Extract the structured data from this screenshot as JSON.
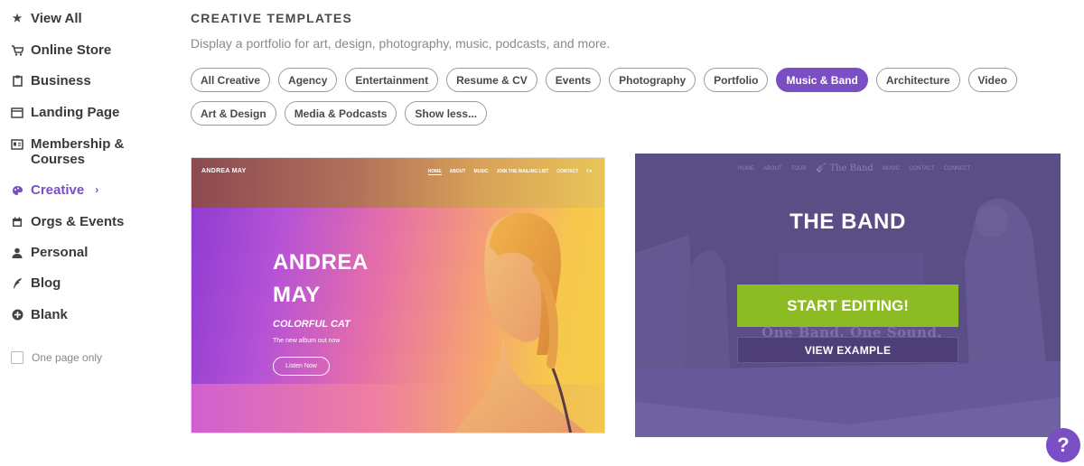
{
  "sidebar": {
    "items": [
      {
        "label": "View All",
        "icon": "star-icon"
      },
      {
        "label": "Online Store",
        "icon": "cart-icon"
      },
      {
        "label": "Business",
        "icon": "clipboard-icon"
      },
      {
        "label": "Landing Page",
        "icon": "browser-window-icon"
      },
      {
        "label": "Membership & Courses",
        "icon": "id-card-icon"
      },
      {
        "label": "Creative",
        "icon": "palette-icon",
        "active": true
      },
      {
        "label": "Orgs & Events",
        "icon": "calendar-icon"
      },
      {
        "label": "Personal",
        "icon": "person-icon"
      },
      {
        "label": "Blog",
        "icon": "quill-icon"
      },
      {
        "label": "Blank",
        "icon": "plus-circle-icon"
      }
    ],
    "one_page_only": "One page only"
  },
  "header": {
    "title": "CREATIVE TEMPLATES",
    "subtitle": "Display a portfolio for art, design, photography, music, podcasts, and more."
  },
  "filters": [
    {
      "label": "All Creative"
    },
    {
      "label": "Agency"
    },
    {
      "label": "Entertainment"
    },
    {
      "label": "Resume & CV"
    },
    {
      "label": "Events"
    },
    {
      "label": "Photography"
    },
    {
      "label": "Portfolio"
    },
    {
      "label": "Music & Band",
      "selected": true
    },
    {
      "label": "Architecture"
    },
    {
      "label": "Video"
    },
    {
      "label": "Art & Design"
    },
    {
      "label": "Media & Podcasts"
    },
    {
      "label": "Show less..."
    }
  ],
  "templates": {
    "andrea": {
      "logo": "ANDREA MAY",
      "menu": [
        "HOME",
        "ABOUT",
        "MUSIC",
        "JOIN THE MAILING LIST",
        "CONTACT",
        "f ▾"
      ],
      "name": "ANDREA MAY",
      "album": "COLORFUL CAT",
      "tagline": "The new album out now",
      "button": "Listen Now"
    },
    "band": {
      "nav": [
        "HOME",
        "ABOUT",
        "TOUR",
        "MUSIC",
        "CONTACT",
        "CONNECT"
      ],
      "nav_logo": "The Band",
      "title": "THE BAND",
      "start_editing": "START EDITING!",
      "view_example": "VIEW EXAMPLE",
      "ghost_text": "One Band. One Sound."
    }
  },
  "help": {
    "label": "?"
  },
  "colors": {
    "accent": "#7b4fc4",
    "start_green": "#8dbb24",
    "band_bg": "#5b4d86"
  }
}
